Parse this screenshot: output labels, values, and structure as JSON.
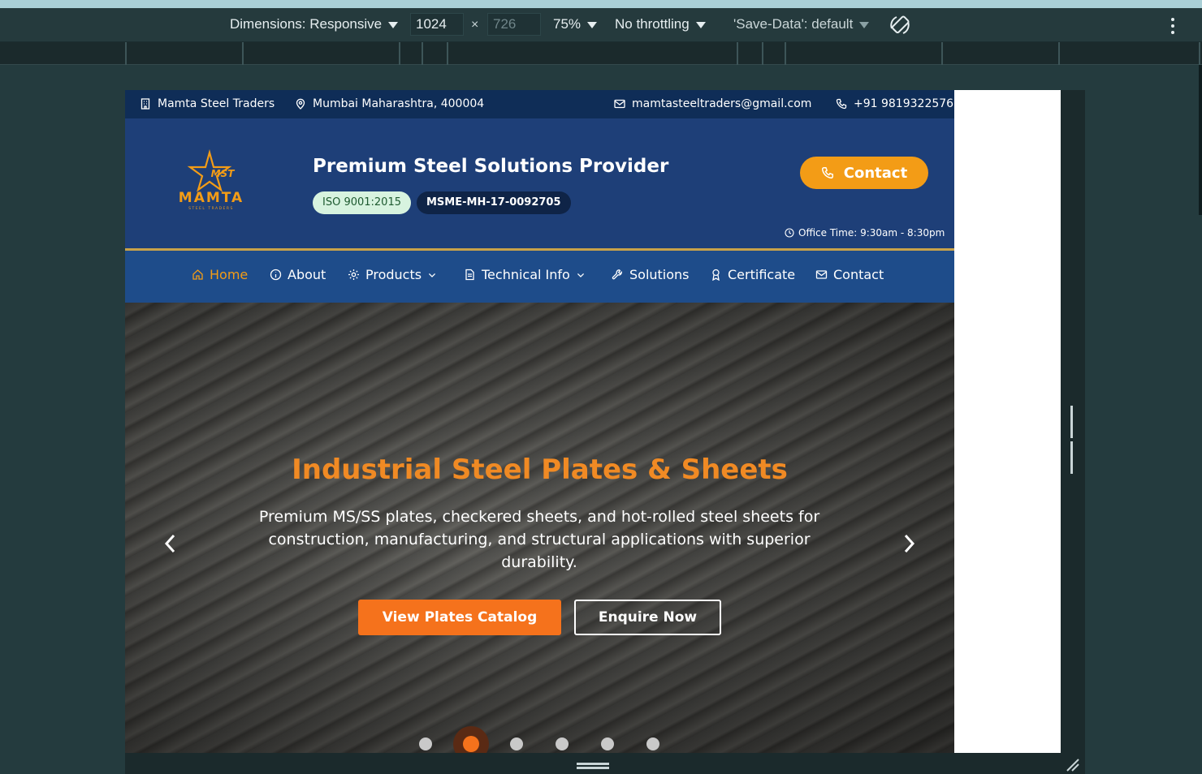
{
  "devtools": {
    "dimensions_label": "Dimensions: Responsive",
    "width_value": "1024",
    "height_value": "726",
    "times": "×",
    "zoom": "75%",
    "throttling": "No throttling",
    "save_data": "'Save-Data': default",
    "icons": [
      "rotate-icon",
      "more-options-icon"
    ]
  },
  "topbar": {
    "company": "Mamta Steel Traders",
    "location": "Mumbai Maharashtra, 400004",
    "email": "mamtasteeltraders@gmail.com",
    "phone": "+91 9819322576"
  },
  "header": {
    "logo_top": "MST",
    "logo_name": "MAMTA",
    "logo_sub": "STEEL TRADERS",
    "tagline": "Premium Steel Solutions Provider",
    "badge_iso": "ISO 9001:2015",
    "badge_msme": "MSME-MH-17-0092705",
    "contact_label": "Contact",
    "office_time": "Office Time: 9:30am - 8:30pm"
  },
  "nav": {
    "items": [
      {
        "label": "Home",
        "icon": "home-icon"
      },
      {
        "label": "About",
        "icon": "info-icon"
      },
      {
        "label": "Products",
        "icon": "gear-icon"
      },
      {
        "label": "Technical Info",
        "icon": "document-icon"
      },
      {
        "label": "Solutions",
        "icon": "wrench-icon"
      },
      {
        "label": "Certificate",
        "icon": "award-icon"
      },
      {
        "label": "Contact",
        "icon": "mail-icon"
      }
    ]
  },
  "hero": {
    "title": "Industrial Steel Plates & Sheets",
    "text": "Premium MS/SS plates, checkered sheets, and hot-rolled steel sheets for construction, manufacturing, and structural applications with superior durability.",
    "primary_button": "View Plates Catalog",
    "secondary_button": "Enquire Now",
    "slide_count": 6,
    "active_slide": 2
  },
  "colors": {
    "accent": "#f39c16",
    "navy": "#1e3f78",
    "topbar": "#0f2d57",
    "hero_title": "#f08a24"
  }
}
